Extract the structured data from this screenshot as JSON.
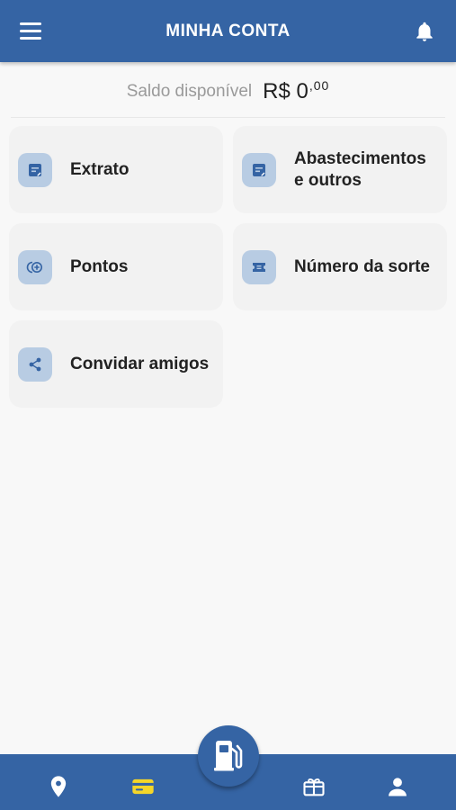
{
  "header": {
    "title": "MINHA CONTA",
    "menu_icon": "hamburger-menu-icon",
    "notification_icon": "bell-icon"
  },
  "balance": {
    "label": "Saldo disponível",
    "amount": "R$ 0",
    "cents": ",00"
  },
  "menu": [
    {
      "label": "Extrato",
      "icon": "statement-icon"
    },
    {
      "label": "Abastecimentos e outros",
      "icon": "fueling-list-icon"
    },
    {
      "label": "Pontos",
      "icon": "coins-icon"
    },
    {
      "label": "Número da sorte",
      "icon": "ticket-icon"
    },
    {
      "label": "Convidar amigos",
      "icon": "share-icon"
    }
  ],
  "bottom_nav": {
    "items": [
      {
        "name": "location",
        "icon": "location-pin-icon",
        "active": false
      },
      {
        "name": "wallet",
        "icon": "wallet-card-icon",
        "active": true
      },
      {
        "name": "gift",
        "icon": "gift-icon",
        "active": false
      },
      {
        "name": "profile",
        "icon": "person-icon",
        "active": false
      }
    ],
    "fab_icon": "fuel-pump-icon"
  },
  "colors": {
    "primary": "#3564a4",
    "active_nav": "#f5d629",
    "icon_tile": "#b8cce3",
    "card_bg": "#f2f2f2",
    "page_bg": "#f8f8f8"
  }
}
